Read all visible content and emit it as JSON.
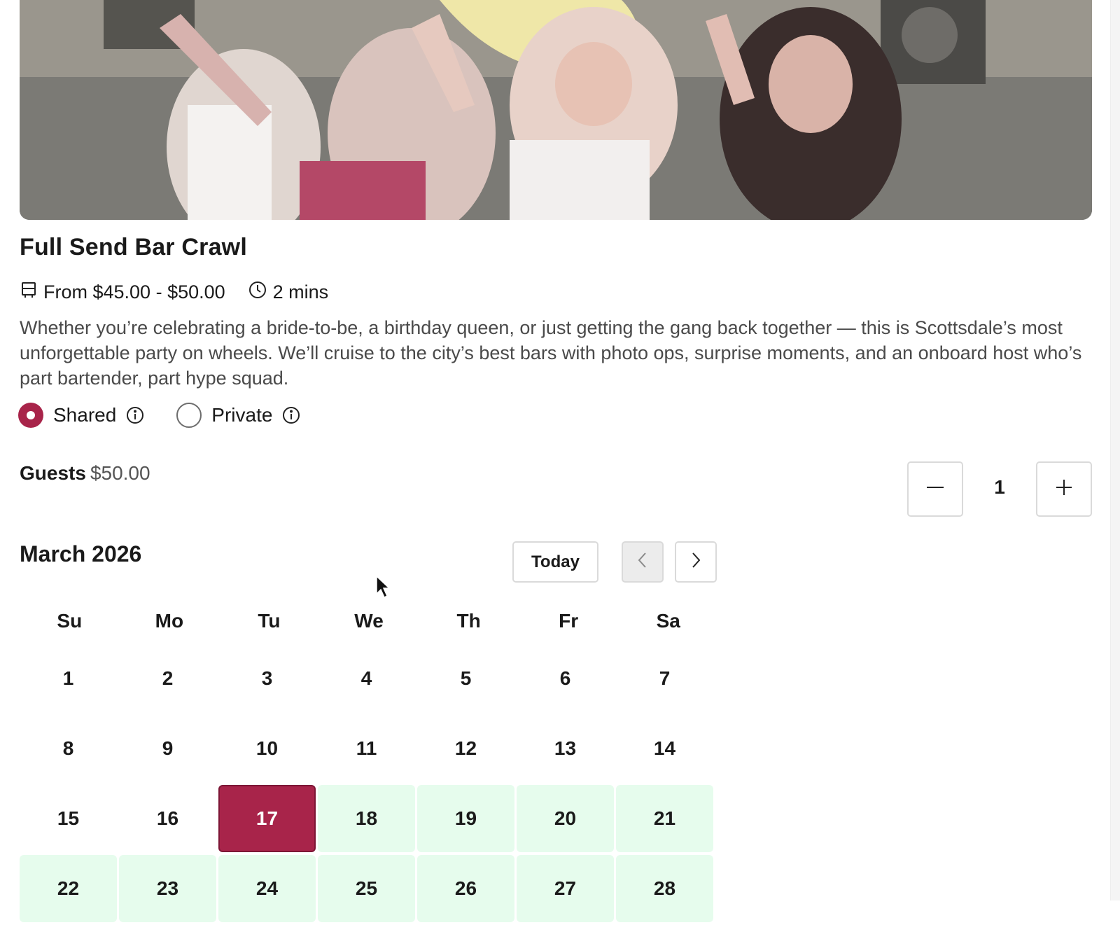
{
  "tour": {
    "title": "Full Send Bar Crawl",
    "price_range": "From $45.00 - $50.00",
    "duration": "2 mins",
    "description": "Whether you’re celebrating a bride-to-be, a birthday queen, or just getting the gang back together — this is Scottsdale’s most unforgettable party on wheels. We’ll cruise to the city’s best bars with photo ops, surprise moments, and an onboard host who’s part bartender, part hype squad.",
    "accent_color": "#a8244a"
  },
  "options": [
    {
      "label": "Shared",
      "selected": true
    },
    {
      "label": "Private",
      "selected": false
    }
  ],
  "guests": {
    "label": "Guests",
    "price": "$50.00",
    "quantity": "1"
  },
  "calendar": {
    "month_label": "March 2026",
    "today_label": "Today",
    "weekdays": [
      "Su",
      "Mo",
      "Tu",
      "We",
      "Th",
      "Fr",
      "Sa"
    ],
    "weeks": [
      [
        "1",
        "2",
        "3",
        "4",
        "5",
        "6",
        "7"
      ],
      [
        "8",
        "9",
        "10",
        "11",
        "12",
        "13",
        "14"
      ],
      [
        "15",
        "16",
        "17",
        "18",
        "19",
        "20",
        "21"
      ],
      [
        "22",
        "23",
        "24",
        "25",
        "26",
        "27",
        "28"
      ]
    ],
    "selected_day": "17",
    "available_days": [
      "18",
      "19",
      "20",
      "21",
      "22",
      "23",
      "24",
      "25",
      "26",
      "27",
      "28"
    ],
    "available_color": "#e6fced"
  }
}
